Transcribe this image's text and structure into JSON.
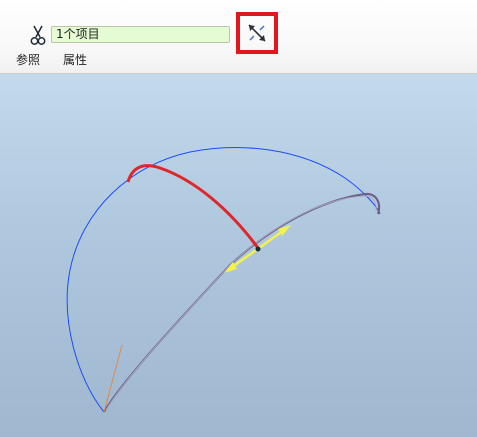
{
  "toolbar": {
    "selection_value": "1个项目",
    "tabs": [
      "参照",
      "属性"
    ],
    "flip_button_highlight_color": "#e2171c"
  },
  "icons": {
    "cut": "scissors-icon",
    "flip": "flip-direction-icon"
  },
  "viewport": {
    "background_top": "#c3d9ec",
    "background_bottom": "#9fb7cf",
    "arc_color": "#1a4cff",
    "selected_curve_color": "#e0262b",
    "direction_arrow_color": "#f2f24a",
    "sweep_curve_color": "#6a5f86"
  }
}
